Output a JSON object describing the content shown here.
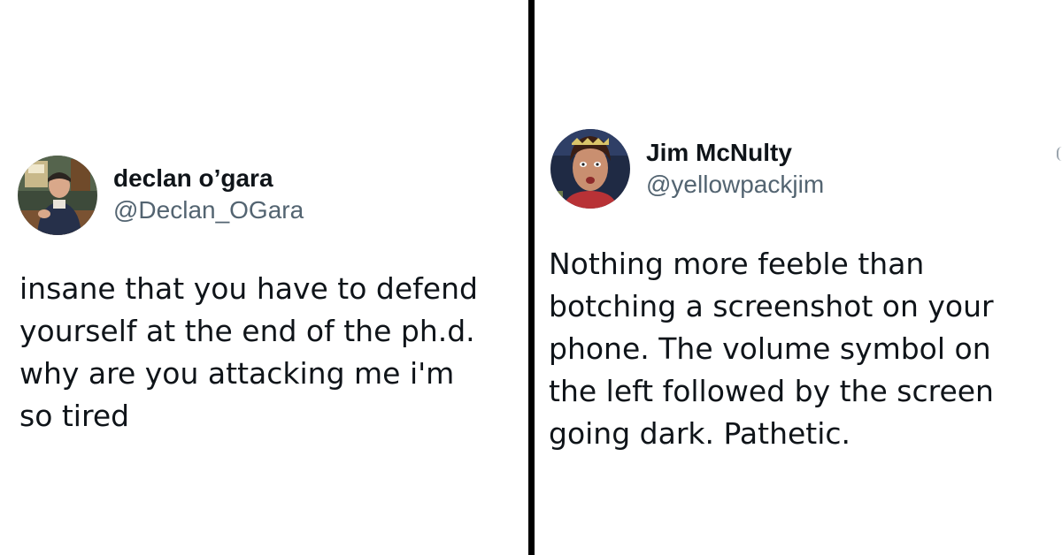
{
  "left_tweet": {
    "display_name": "declan o’gara",
    "handle": "@Declan_OGara",
    "text_lines": [
      "insane that you have to defend",
      "yourself at the end of the ph.d.",
      "why are you attacking me i'm",
      "so tired"
    ],
    "avatar_icon": "user-photo-avatar-icon"
  },
  "right_tweet": {
    "display_name": "Jim McNulty",
    "handle": "@yellowpackjim",
    "text_lines": [
      "Nothing more feeble than",
      "botching a screenshot on your",
      "phone. The volume symbol on",
      "the left followed by the screen",
      "going dark. Pathetic."
    ],
    "avatar_icon": "user-photo-avatar-icon"
  },
  "colors": {
    "background": "#ffffff",
    "divider": "#000000",
    "name_text": "#0f1419",
    "handle_text": "#536471"
  }
}
